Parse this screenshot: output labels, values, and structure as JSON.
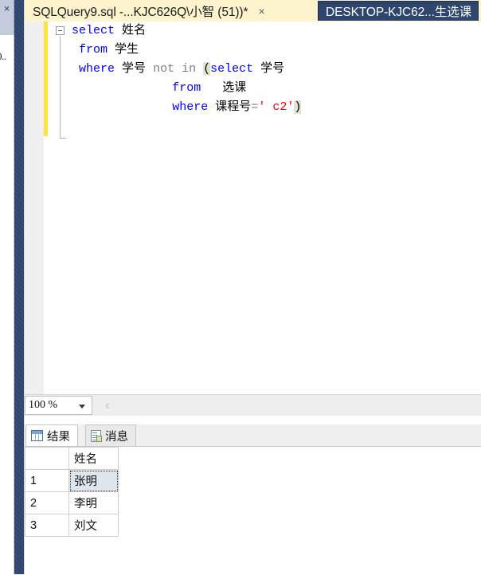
{
  "window": {
    "dock_close_icon": "close-icon",
    "dock_clipped_text": "0.."
  },
  "tabs": [
    {
      "label": "SQLQuery9.sql -...KJC626Q\\小智 (51))*",
      "active": true,
      "close_label": "×",
      "name": "tab-sqlquery9"
    },
    {
      "label": "DESKTOP-KJC62...生选课",
      "active": false,
      "name": "tab-desktop-kjc62"
    }
  ],
  "editor": {
    "outlining": "collapse-minus",
    "lines": [
      {
        "indent": 0,
        "tokens": [
          {
            "t": "select",
            "c": "kw"
          },
          {
            "t": " ",
            "c": "plain"
          },
          {
            "t": "姓名",
            "c": "ident"
          }
        ]
      },
      {
        "indent": 1,
        "tokens": [
          {
            "t": "from",
            "c": "kw"
          },
          {
            "t": " ",
            "c": "plain"
          },
          {
            "t": "学生",
            "c": "ident"
          }
        ]
      },
      {
        "indent": 1,
        "tokens": [
          {
            "t": "where",
            "c": "kw"
          },
          {
            "t": " ",
            "c": "plain"
          },
          {
            "t": "学号",
            "c": "ident"
          },
          {
            "t": " ",
            "c": "plain"
          },
          {
            "t": "not in ",
            "c": "op"
          },
          {
            "t": "(",
            "c": "brk"
          },
          {
            "t": "select",
            "c": "kw"
          },
          {
            "t": " ",
            "c": "plain"
          },
          {
            "t": "学号",
            "c": "ident"
          }
        ]
      },
      {
        "indent": 14,
        "tokens": [
          {
            "t": "from",
            "c": "kw"
          },
          {
            "t": "   ",
            "c": "plain"
          },
          {
            "t": "选课",
            "c": "ident"
          }
        ]
      },
      {
        "indent": 14,
        "tokens": [
          {
            "t": "where",
            "c": "kw"
          },
          {
            "t": " ",
            "c": "plain"
          },
          {
            "t": "课程号",
            "c": "ident"
          },
          {
            "t": "=",
            "c": "op"
          },
          {
            "t": "' c2'",
            "c": "str"
          },
          {
            "t": ")",
            "c": "brk"
          }
        ]
      }
    ]
  },
  "statusbar": {
    "zoom_value": "100 %",
    "nav_back_label": "‹"
  },
  "results_tabs": [
    {
      "label": "结果",
      "icon": "grid-icon",
      "active": true,
      "name": "tab-results"
    },
    {
      "label": "消息",
      "icon": "message-icon",
      "active": false,
      "name": "tab-messages"
    }
  ],
  "results_grid": {
    "row_header": "",
    "columns": [
      "姓名"
    ],
    "rows": [
      {
        "num": "1",
        "姓名": "张明",
        "selected": true
      },
      {
        "num": "2",
        "姓名": "李明",
        "selected": false
      },
      {
        "num": "3",
        "姓名": "刘文",
        "selected": false
      }
    ]
  },
  "colors": {
    "tab_active_bg": "#fdf4cd",
    "tab_inactive_bg": "#2e456e",
    "keyword": "#0000ff",
    "string": "#ff0000",
    "operator": "#808080",
    "change_bar": "#ffe342",
    "navy_strip": "#2e456e",
    "selected_cell": "#dfe5ec"
  }
}
